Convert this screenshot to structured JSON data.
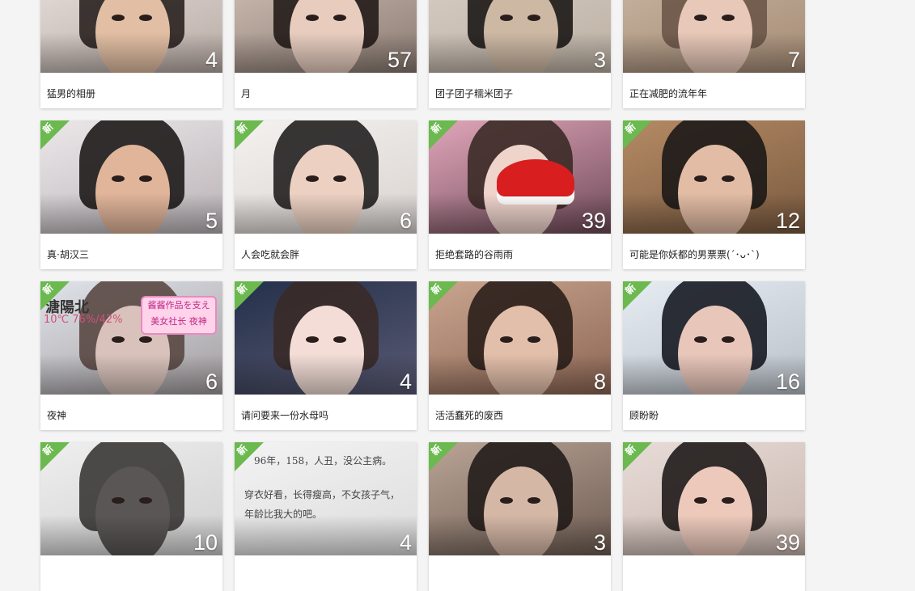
{
  "albums": [
    {
      "name": "猛男的相册",
      "count": "4",
      "is_new": false,
      "bg": [
        "#e8e2de",
        "#b8aaa4"
      ],
      "skin": "#e2bfa4",
      "hair": "#2a2220"
    },
    {
      "name": "月",
      "count": "57",
      "is_new": false,
      "bg": [
        "#d3c3b8",
        "#8a7a72"
      ],
      "skin": "#e8cdbf",
      "hair": "#241c1a"
    },
    {
      "name": "团子团子糯米团子",
      "count": "3",
      "is_new": false,
      "bg": [
        "#d9cfc6",
        "#bcb0a3"
      ],
      "skin": "#cdb8a4",
      "hair": "#1c1816"
    },
    {
      "name": "正在减肥的流年年",
      "count": "7",
      "is_new": false,
      "bg": [
        "#c9b7a3",
        "#a68c76"
      ],
      "skin": "#e8c8b8",
      "hair": "#6b5648"
    },
    {
      "name": "真·胡汉三",
      "count": "5",
      "is_new": true,
      "bg": [
        "#ece8ea",
        "#b9b2b6"
      ],
      "skin": "#e0b59a",
      "hair": "#1e1a1a"
    },
    {
      "name": "人会吃就会胖",
      "count": "6",
      "is_new": true,
      "bg": [
        "#f4f1ef",
        "#d9d3cf"
      ],
      "skin": "#ecd1c2",
      "hair": "#222020"
    },
    {
      "name": "拒绝套路的谷雨雨",
      "count": "39",
      "is_new": true,
      "bg": [
        "#e0a6ba",
        "#6f4a58"
      ],
      "skin": "#efd4cc",
      "hair": "#3b2a26"
    },
    {
      "name": "可能是你妖都的男票票(´･ᴗ･`)",
      "count": "12",
      "is_new": true,
      "bg": [
        "#b48a64",
        "#7a5a40"
      ],
      "skin": "#e2bca4",
      "hair": "#1c1817"
    },
    {
      "name": "夜神",
      "count": "6",
      "is_new": true,
      "bg": [
        "#dfe3ea",
        "#a39d9f"
      ],
      "skin": "#d9c2bb",
      "hair": "#5a4844"
    },
    {
      "name": "请问要来一份水母吗",
      "count": "4",
      "is_new": true,
      "bg": [
        "#24304a",
        "#5a5a74"
      ],
      "skin": "#f3ddd6",
      "hair": "#3a2a28"
    },
    {
      "name": "活活蠢死的废西",
      "count": "8",
      "is_new": true,
      "bg": [
        "#c9a48e",
        "#8c6654"
      ],
      "skin": "#e2bfaa",
      "hair": "#2a1e1a"
    },
    {
      "name": "顾盼盼",
      "count": "16",
      "is_new": true,
      "bg": [
        "#e6ecf2",
        "#b9c0c8"
      ],
      "skin": "#e8c6ba",
      "hair": "#161a22"
    },
    {
      "name": "",
      "count": "10",
      "is_new": true,
      "bg": [
        "#efefef",
        "#cfcfcf"
      ],
      "skin": "#5a5656",
      "hair": "#3a3636"
    },
    {
      "name": "",
      "count": "4",
      "is_new": true,
      "bg": [
        "#f3f3f3",
        "#dcdcdc"
      ],
      "skin": "#f3f3f3",
      "hair": "#f3f3f3"
    },
    {
      "name": "",
      "count": "3",
      "is_new": true,
      "bg": [
        "#b9a496",
        "#6e5c52"
      ],
      "skin": "#d5b7a6",
      "hair": "#221c1a"
    },
    {
      "name": "",
      "count": "39",
      "is_new": true,
      "bg": [
        "#e8dcd8",
        "#c8b5ad"
      ],
      "skin": "#ecc9bb",
      "hair": "#1f1a1a"
    }
  ],
  "new_badge": "新",
  "texts": {
    "ch1": "溏陽北",
    "ch2": "10℃ 76%/42%",
    "sign1": "酱酱作品を支え",
    "sign2": "美女社长 夜神",
    "poem1": "96年，158，人丑，没公主病。",
    "poem2": "穿衣好看，长得瘦高，不女孩子气，",
    "poem3": "年龄比我大的吧。"
  }
}
